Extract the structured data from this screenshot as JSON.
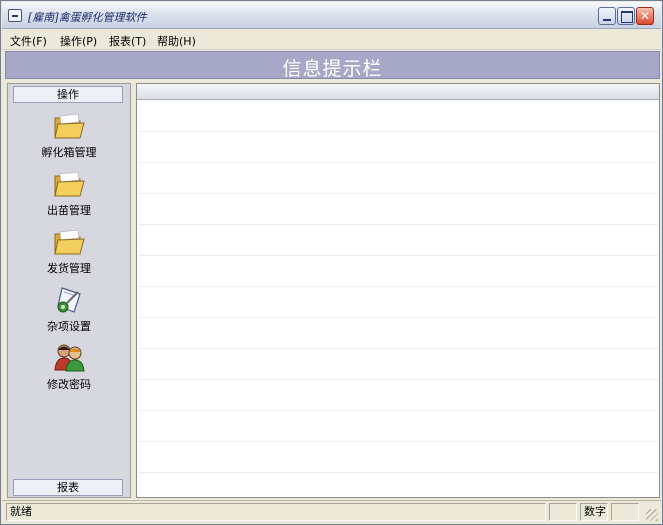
{
  "window": {
    "title": "[雇南]禽蛋孵化管理软件",
    "buttons": {
      "minimize": "_",
      "maximize": "",
      "close": "✕"
    }
  },
  "menu": {
    "items": [
      {
        "label": "文件(F)"
      },
      {
        "label": "操作(P)"
      },
      {
        "label": "报表(T)"
      },
      {
        "label": "帮助(H)"
      }
    ]
  },
  "banner": {
    "text": "信息提示栏"
  },
  "sidebar": {
    "header": "操作",
    "footer": "报表",
    "items": [
      {
        "label": "孵化箱管理",
        "icon": "folder-open-icon"
      },
      {
        "label": "出苗管理",
        "icon": "folder-open-icon"
      },
      {
        "label": "发货管理",
        "icon": "folder-open-icon"
      },
      {
        "label": "杂项设置",
        "icon": "settings-tools-icon"
      },
      {
        "label": "修改密码",
        "icon": "users-icon"
      }
    ]
  },
  "status": {
    "left": "就绪",
    "numlock": "数字"
  },
  "colors": {
    "banner": "#a7a8c7",
    "sidebar": "#d7d8df",
    "folder": "#e9c24e"
  }
}
